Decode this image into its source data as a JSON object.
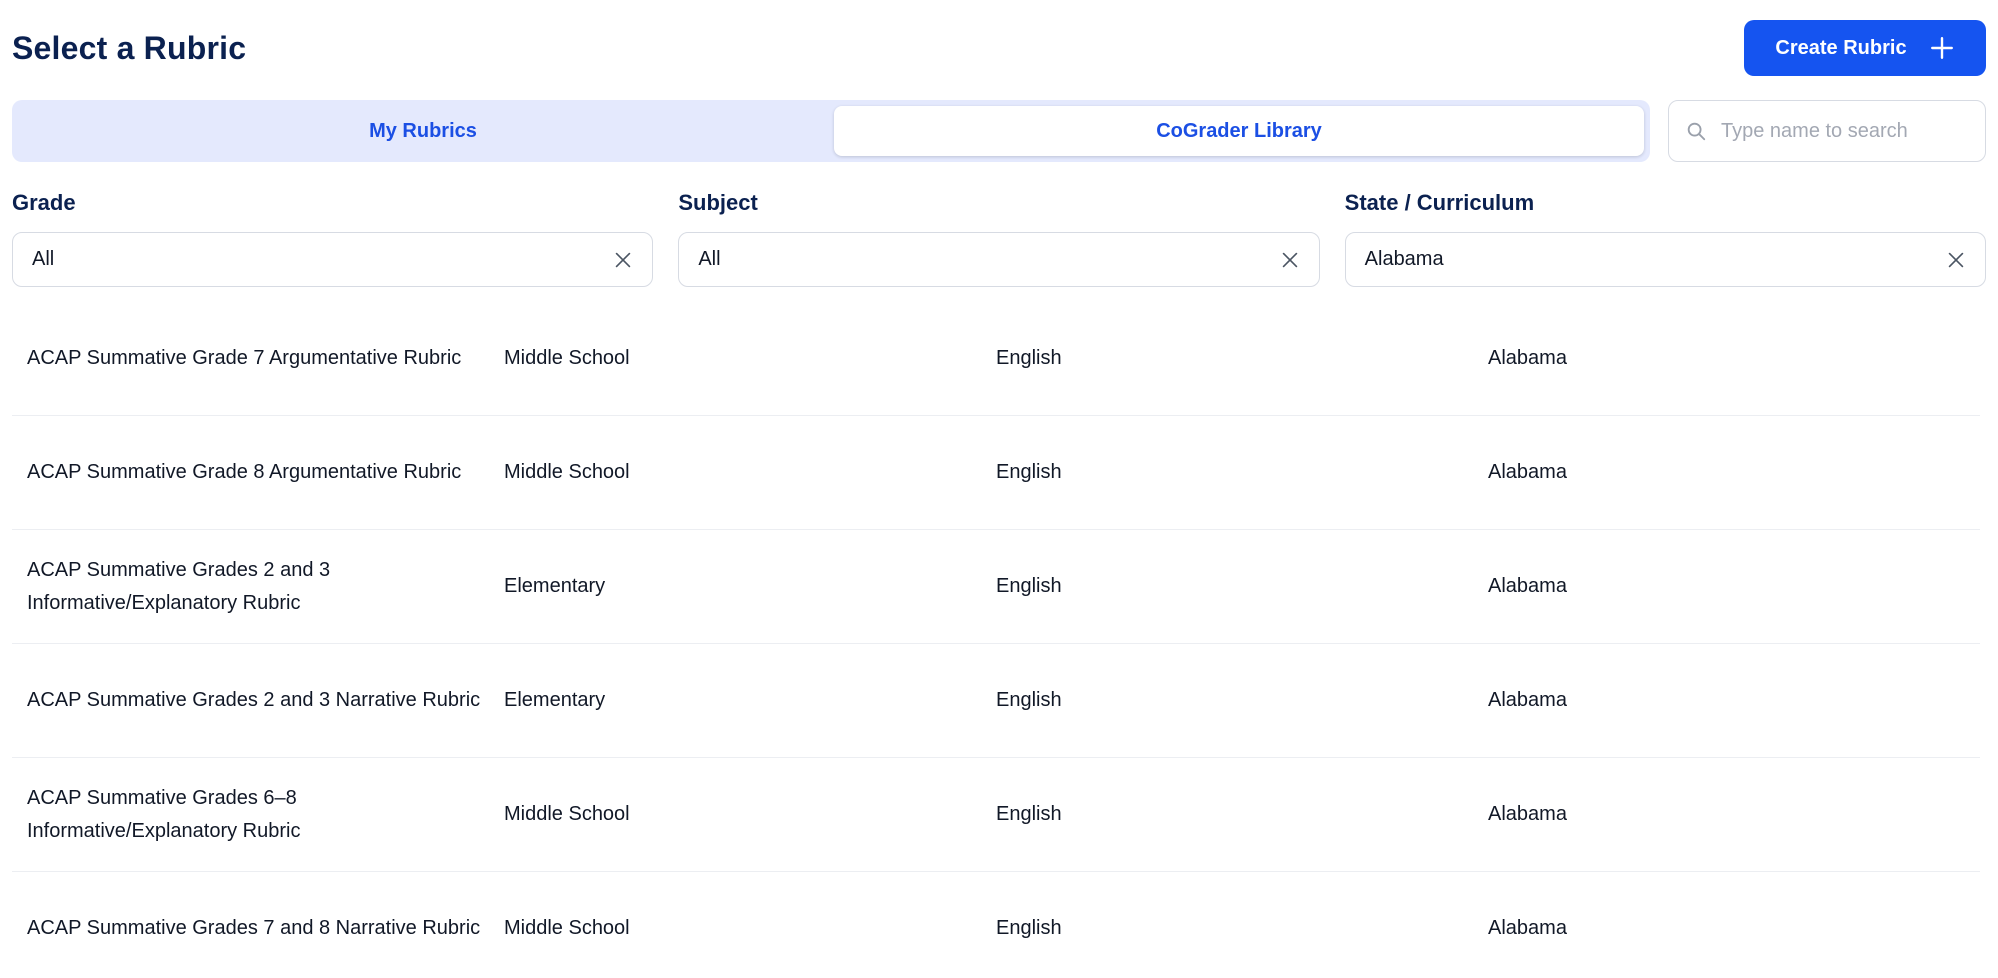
{
  "header": {
    "title": "Select a Rubric",
    "create_button_label": "Create Rubric"
  },
  "tabs": [
    {
      "label": "My Rubrics",
      "active": false
    },
    {
      "label": "CoGrader Library",
      "active": true
    }
  ],
  "search": {
    "placeholder": "Type name to search",
    "value": ""
  },
  "filters": {
    "grade": {
      "label": "Grade",
      "value": "All"
    },
    "subject": {
      "label": "Subject",
      "value": "All"
    },
    "state": {
      "label": "State / Curriculum",
      "value": "Alabama"
    }
  },
  "rubrics": [
    {
      "name": "ACAP Summative Grade 7 Argumentative Rubric",
      "grade": "Middle School",
      "subject": "English",
      "state": "Alabama"
    },
    {
      "name": "ACAP Summative Grade 8 Argumentative Rubric",
      "grade": "Middle School",
      "subject": "English",
      "state": "Alabama"
    },
    {
      "name": "ACAP Summative Grades 2 and 3 Informative/Explanatory Rubric",
      "grade": "Elementary",
      "subject": "English",
      "state": "Alabama"
    },
    {
      "name": "ACAP Summative Grades 2 and 3 Narrative Rubric",
      "grade": "Elementary",
      "subject": "English",
      "state": "Alabama"
    },
    {
      "name": "ACAP Summative Grades 6–8 Informative/Explanatory Rubric",
      "grade": "Middle School",
      "subject": "English",
      "state": "Alabama"
    },
    {
      "name": "ACAP Summative Grades 7 and 8 Narrative Rubric",
      "grade": "Middle School",
      "subject": "English",
      "state": "Alabama"
    }
  ],
  "colors": {
    "primary": "#1554f0",
    "title": "#0b2150",
    "tab_bg": "#e4e9fd"
  },
  "icons": {
    "create": "plus-icon",
    "search": "search-icon",
    "clear": "close-icon"
  }
}
